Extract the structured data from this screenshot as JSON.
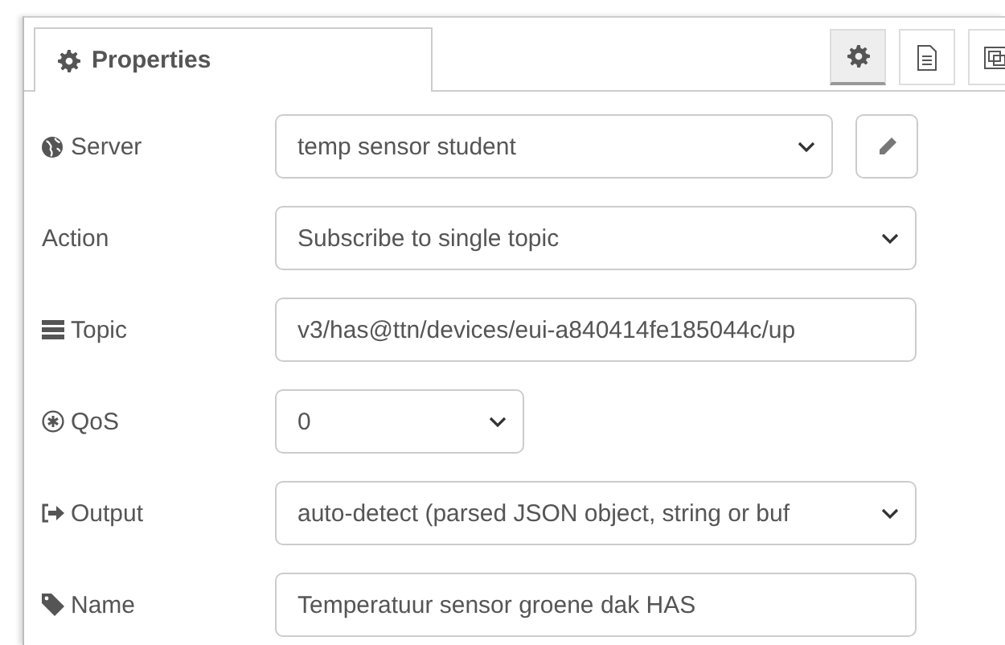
{
  "tabs": [
    {
      "label": "Properties",
      "selected": true
    }
  ],
  "side_buttons": [
    {
      "selected": true
    },
    {
      "selected": false
    },
    {
      "selected": false
    }
  ],
  "rows": [
    {
      "label": "Server",
      "kind": "select-edit",
      "value": "temp sensor student"
    },
    {
      "label": "Action",
      "kind": "select",
      "value": "Subscribe to single topic"
    },
    {
      "label": "Topic",
      "kind": "input",
      "value": "v3/has@ttn/devices/eui-a840414fe185044c/up"
    },
    {
      "label": "QoS",
      "kind": "short-select",
      "value": "0"
    },
    {
      "label": "Output",
      "kind": "select",
      "value": "auto-detect (parsed JSON object, string or buf"
    },
    {
      "label": "Name",
      "kind": "input",
      "value": "Temperatuur sensor groene dak HAS"
    }
  ]
}
